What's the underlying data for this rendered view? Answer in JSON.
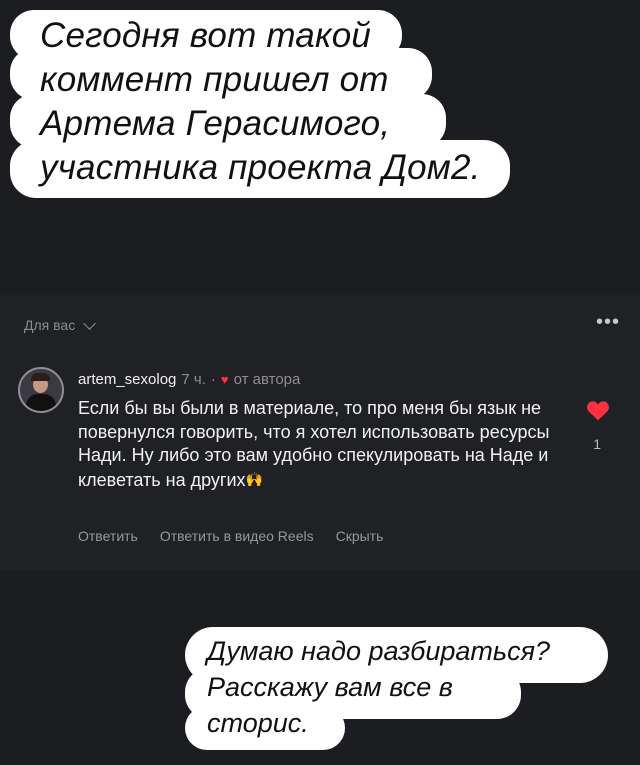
{
  "top_message": {
    "lines": [
      "Сегодня вот такой",
      "коммент пришел от",
      "Артема Герасимого,",
      "участника проекта Дом2."
    ]
  },
  "comments_header": {
    "section_label": "Для вас",
    "more_icon": "ellipsis-icon"
  },
  "comment": {
    "username": "artem_sexolog",
    "time": "7 ч.",
    "separator": "·",
    "author_label": "от автора",
    "text": "Если бы вы были в материале, то про меня бы язык не повернулся говорить, что я хотел использовать ресурсы Нади. Ну либо это вам удобно спекулировать на Наде и клеветать на других",
    "emoji": "🙌",
    "like_count": "1",
    "like_color": "#ff3040",
    "actions": {
      "reply": "Ответить",
      "reply_video": "Ответить в видео Reels",
      "hide": "Скрыть"
    }
  },
  "bottom_message": {
    "lines": [
      "Думаю надо разбираться?",
      "Расскажу вам все в",
      "сторис."
    ]
  }
}
